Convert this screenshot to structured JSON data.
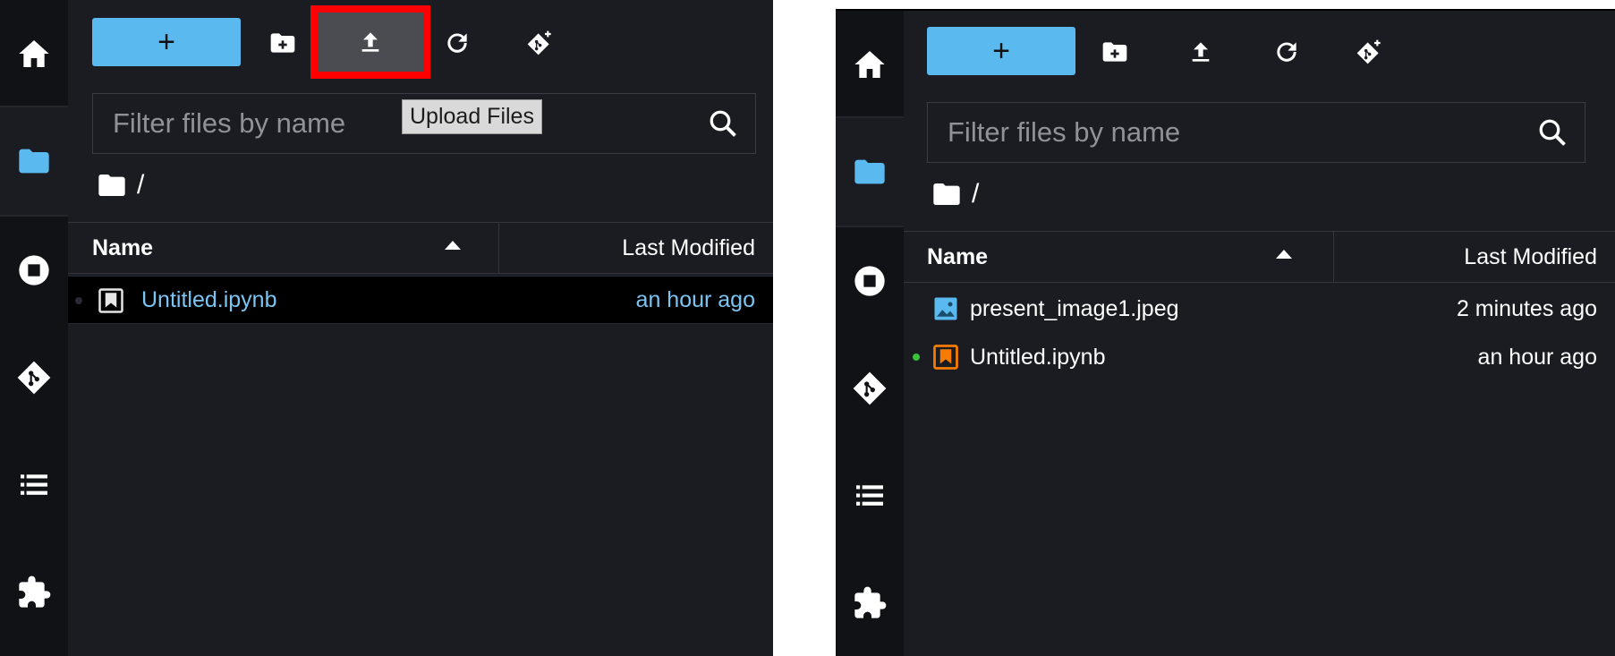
{
  "left_panel": {
    "toolbar": {
      "new_label": "+",
      "new_folder_icon": "new-folder-icon",
      "upload_icon": "upload-icon",
      "refresh_icon": "refresh-icon",
      "git_icon": "git-clone-icon",
      "highlight_color": "#ff0000"
    },
    "tooltip": "Upload Files",
    "filter": {
      "placeholder": "Filter files by name"
    },
    "breadcrumb": "/",
    "table": {
      "col_name": "Name",
      "col_modified": "Last Modified",
      "rows": [
        {
          "name": "Untitled.ipynb",
          "modified": "an hour ago",
          "type": "notebook"
        }
      ]
    }
  },
  "right_panel": {
    "toolbar": {
      "new_label": "+",
      "new_folder_icon": "new-folder-icon",
      "upload_icon": "upload-icon",
      "refresh_icon": "refresh-icon",
      "git_icon": "git-clone-icon"
    },
    "filter": {
      "placeholder": "Filter files by name"
    },
    "breadcrumb": "/",
    "table": {
      "col_name": "Name",
      "col_modified": "Last Modified",
      "rows": [
        {
          "name": "present_image1.jpeg",
          "modified": "2 minutes ago",
          "type": "image"
        },
        {
          "name": "Untitled.ipynb",
          "modified": "an hour ago",
          "type": "notebook",
          "running": true
        }
      ]
    }
  },
  "sidebar_icons": [
    "home-icon",
    "folder-icon",
    "stop-circle-icon",
    "git-icon",
    "list-icon",
    "extension-icon"
  ],
  "colors": {
    "accent": "#5ab9ee",
    "background": "#1b1c21",
    "rail": "#111216",
    "selected_text": "#7cc4f2",
    "running_dot": "#3ac23a",
    "notebook_orange": "#f57c00"
  }
}
